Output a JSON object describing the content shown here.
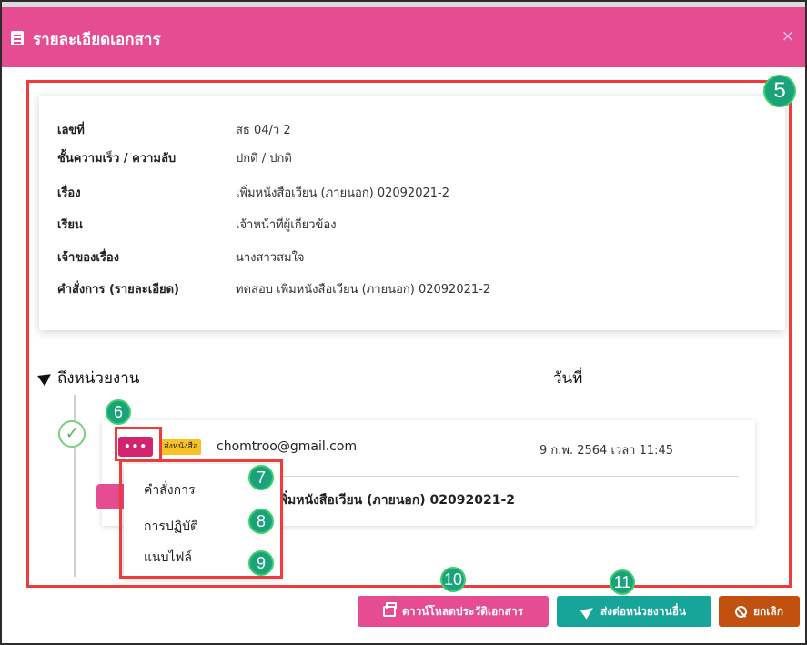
{
  "header": {
    "title": "รายละเอียดเอกสาร",
    "close_label": "×"
  },
  "details": [
    {
      "label": "เลขที่",
      "value": "สธ 04/ว 2"
    },
    {
      "label": "ชั้นความเร็ว / ความลับ",
      "value": "ปกติ / ปกติ"
    },
    {
      "label": "เรื่อง",
      "value": "เพิ่มหนังสือเวียน (ภายนอก) 02092021-2"
    },
    {
      "label": "เรียน",
      "value": "เจ้าหน้าที่ผู้เกี่ยวข้อง"
    },
    {
      "label": "เจ้าของเรื่อง",
      "value": "นางสาวสมใจ"
    },
    {
      "label": "คำสั่งการ (รายละเอียด)",
      "value": "ทดสอบ เพิ่มหนังสือเวียน (ภายนอก) 02092021-2"
    }
  ],
  "timeline": {
    "to_unit_label": "ถึงหน่วยงาน",
    "date_label": "วันที่",
    "entry": {
      "more_label": "•••",
      "tag": "ส่งหนังสือ",
      "email": "chomtroo@gmail.com",
      "datetime": "9 ก.พ. 2564 เวลา 11:45",
      "subject": "เพิ่มหนังสือเวียน (ภายนอก) 02092021-2"
    }
  },
  "menu": {
    "items": [
      "คำสั่งการ",
      "การปฏิบัติ",
      "แนบไฟล์"
    ]
  },
  "callouts": {
    "n5": "5",
    "n6": "6",
    "n7": "7",
    "n8": "8",
    "n9": "9",
    "n10": "10",
    "n11": "11"
  },
  "footer": {
    "download_label": "ดาวน์โหลดประวัติเอกสาร",
    "forward_label": "ส่งต่อหน่วยงานอื่น",
    "cancel_label": "ยกเลิก"
  },
  "colors": {
    "header": "#e64c92",
    "highlight": "#ee3b3b",
    "callout": "#1aa37a",
    "forward": "#17a59a",
    "cancel": "#c2500f"
  }
}
